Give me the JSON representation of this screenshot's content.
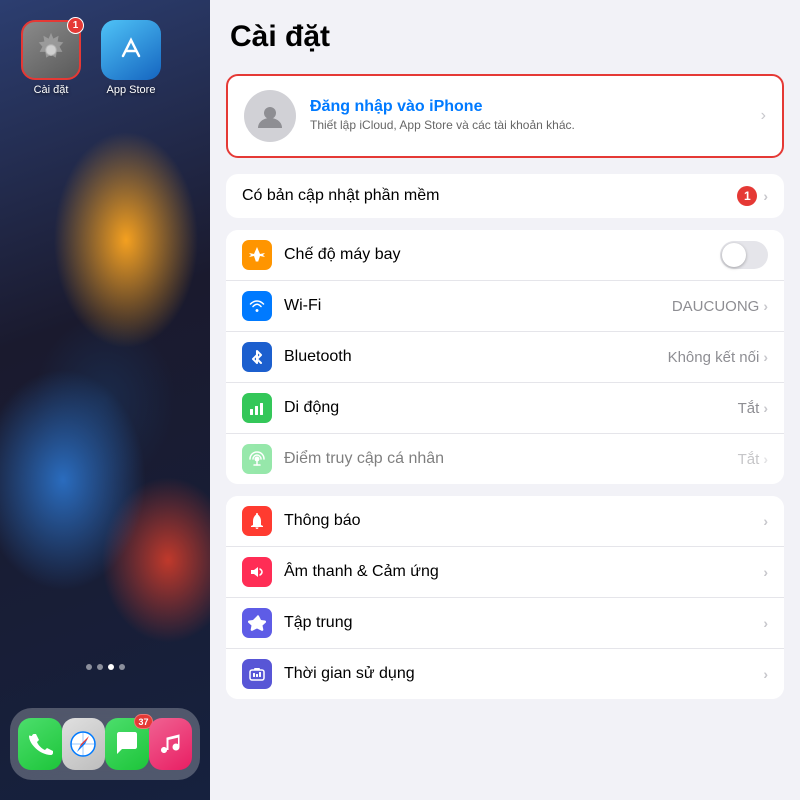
{
  "homescreen": {
    "apps": [
      {
        "id": "settings",
        "label": "Cài đặt",
        "badge": "1"
      },
      {
        "id": "appstore",
        "label": "App Store",
        "badge": null
      }
    ],
    "dots": [
      {
        "active": false
      },
      {
        "active": false
      },
      {
        "active": true
      },
      {
        "active": false
      }
    ],
    "dock": [
      {
        "id": "phone",
        "badge": null
      },
      {
        "id": "safari",
        "badge": null
      },
      {
        "id": "messages",
        "badge": "37"
      },
      {
        "id": "music",
        "badge": null
      }
    ]
  },
  "settings": {
    "title": "Cài đặt",
    "profile": {
      "signin_label": "Đăng nhập vào iPhone",
      "description": "Thiết lập iCloud, App Store và các tài khoản khác."
    },
    "update_row": {
      "label": "Có bản cập nhật phần mềm",
      "badge": "1"
    },
    "rows_group1": [
      {
        "id": "airplane",
        "label": "Chế độ máy bay",
        "value": "",
        "toggle": true,
        "icon_bg": "bg-orange"
      },
      {
        "id": "wifi",
        "label": "Wi-Fi",
        "value": "DAUCUONG",
        "toggle": false,
        "icon_bg": "bg-blue"
      },
      {
        "id": "bluetooth",
        "label": "Bluetooth",
        "value": "Không kết nối",
        "toggle": false,
        "icon_bg": "bg-blue-dark"
      },
      {
        "id": "cellular",
        "label": "Di động",
        "value": "Tắt",
        "toggle": false,
        "icon_bg": "bg-green"
      },
      {
        "id": "hotspot",
        "label": "Điểm truy cập cá nhân",
        "value": "Tắt",
        "toggle": false,
        "icon_bg": "bg-green-light",
        "disabled": true
      }
    ],
    "rows_group2": [
      {
        "id": "notifications",
        "label": "Thông báo",
        "value": "",
        "toggle": false,
        "icon_bg": "bg-red"
      },
      {
        "id": "sounds",
        "label": "Âm thanh & Cảm ứng",
        "value": "",
        "toggle": false,
        "icon_bg": "bg-pink"
      },
      {
        "id": "focus",
        "label": "Tập trung",
        "value": "",
        "toggle": false,
        "icon_bg": "bg-indigo"
      },
      {
        "id": "screentime",
        "label": "Thời gian sử dụng",
        "value": "",
        "toggle": false,
        "icon_bg": "bg-purple"
      }
    ]
  }
}
